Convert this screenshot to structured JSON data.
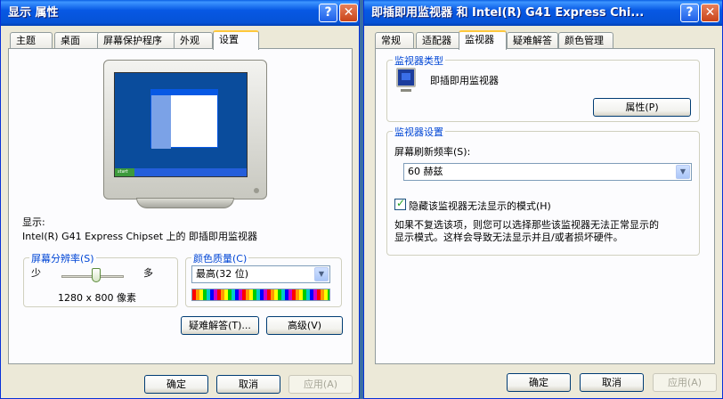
{
  "display_props": {
    "title": "显示 属性",
    "tabs": [
      "主题",
      "桌面",
      "屏幕保护程序",
      "外观",
      "设置"
    ],
    "display_label": "显示:",
    "display_value": "Intel(R) G41 Express Chipset 上的 即插即用监视器",
    "resolution": {
      "legend": "屏幕分辨率(S)",
      "less": "少",
      "more": "多",
      "value": "1280 x 800 像素",
      "slider_fraction": 0.55
    },
    "color_quality": {
      "legend": "颜色质量(C)",
      "selected": "最高(32 位)"
    },
    "troubleshoot_label": "疑难解答(T)...",
    "advanced_label": "高级(V)",
    "ok_label": "确定",
    "cancel_label": "取消",
    "apply_label": "应用(A)",
    "desktop_preview": {
      "start": "start"
    }
  },
  "monitor_props": {
    "title": "即插即用监视器 和 Intel(R) G41 Express Chi...",
    "tabs": [
      "常规",
      "适配器",
      "监视器",
      "疑难解答",
      "颜色管理"
    ],
    "type_group": {
      "legend": "监视器类型",
      "name": "即插即用监视器",
      "properties_label": "属性(P)"
    },
    "settings_group": {
      "legend": "监视器设置",
      "refresh_label": "屏幕刷新频率(S):",
      "refresh_value": "60 赫兹",
      "hide_modes_label": "隐藏该监视器无法显示的模式(H)",
      "hide_modes_checked": true,
      "hint_line1": "如果不复选该项，则您可以选择那些该监视器无法正常显示的",
      "hint_line2": "显示模式。这样会导致无法显示并且/或者损坏硬件。"
    },
    "ok_label": "确定",
    "cancel_label": "取消",
    "apply_label": "应用(A)"
  },
  "colors": {
    "title_blue": "#0758e4",
    "desktop_blue": "#0a4c9c",
    "accent_orange": "#ffc83c",
    "legend_blue": "#0046d5"
  }
}
